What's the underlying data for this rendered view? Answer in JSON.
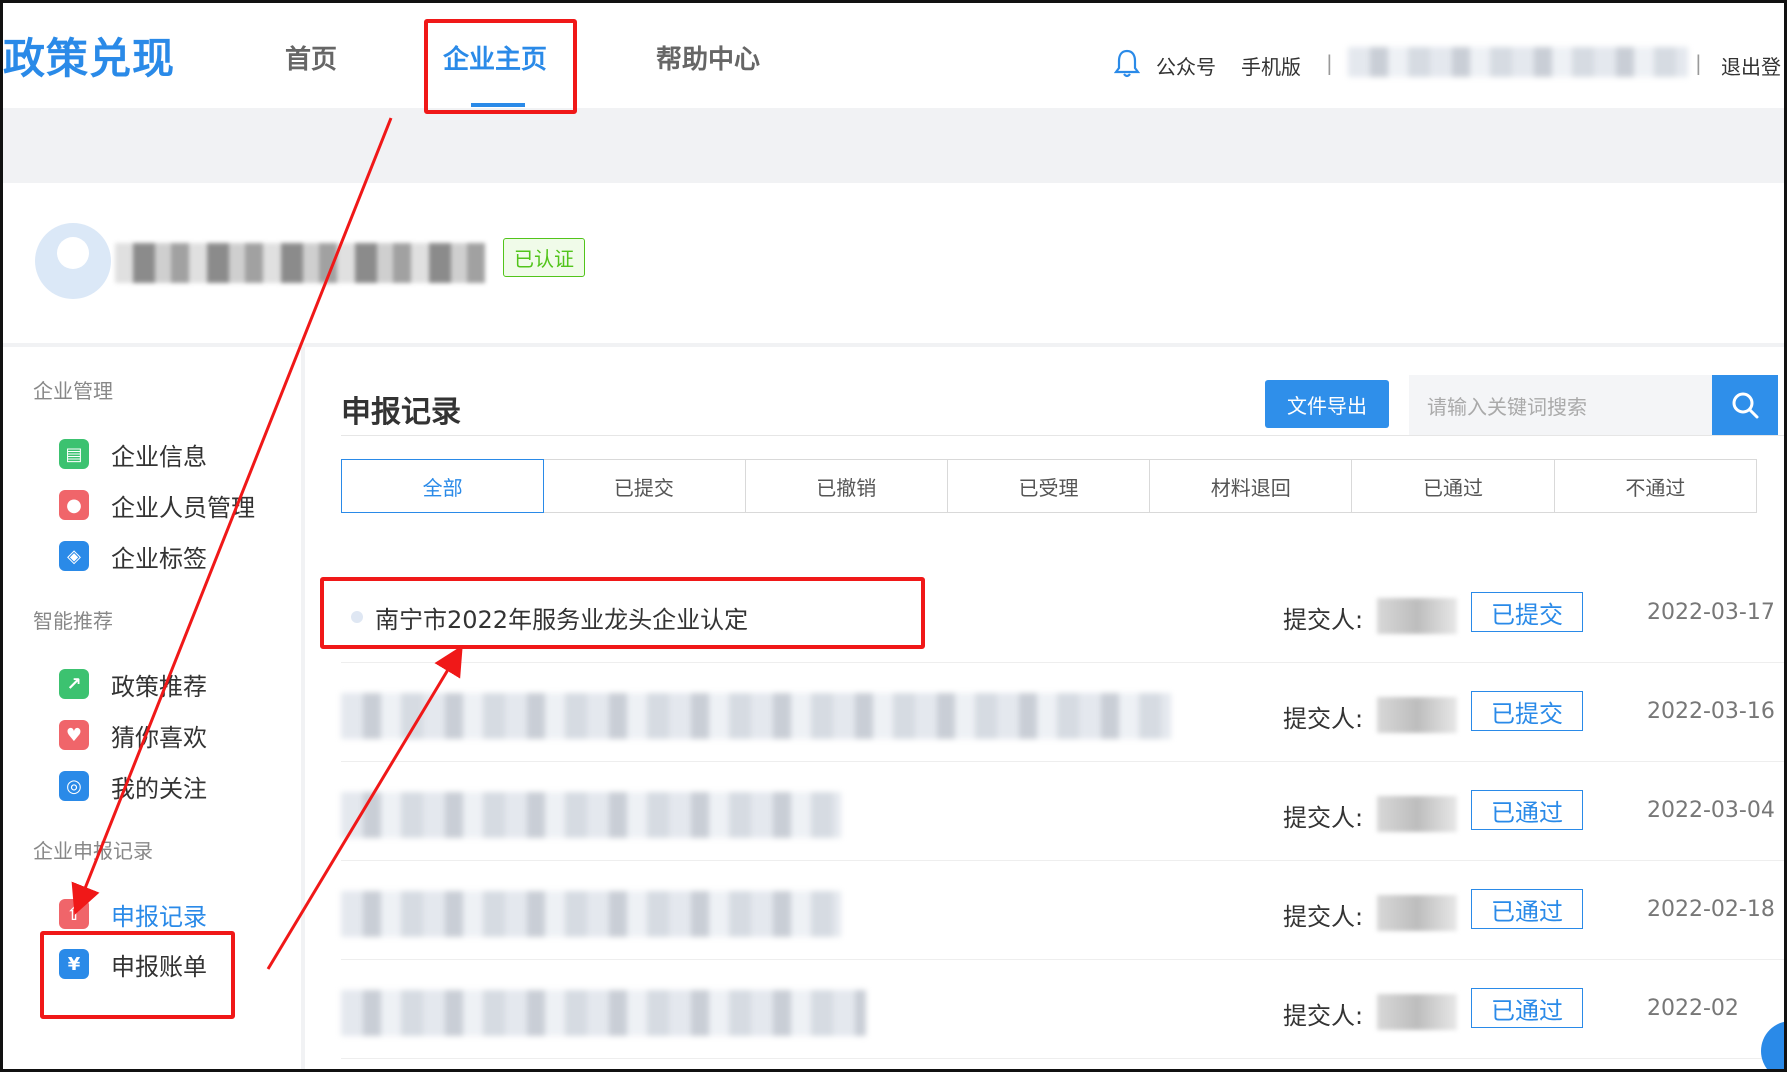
{
  "header": {
    "logo": "政策兑现",
    "nav": [
      "首页",
      "企业主页",
      "帮助中心"
    ],
    "links": {
      "wechat": "公众号",
      "mobile": "手机版",
      "logout": "退出登"
    }
  },
  "profile": {
    "badge": "已认证"
  },
  "sidebar": {
    "groups": [
      {
        "title": "企业管理",
        "items": [
          {
            "label": "企业信息",
            "icon": "building-icon",
            "color": "#3cc270"
          },
          {
            "label": "企业人员管理",
            "icon": "person-icon",
            "color": "#f0656a"
          },
          {
            "label": "企业标签",
            "icon": "tag-icon",
            "color": "#2a8ae8"
          }
        ]
      },
      {
        "title": "智能推荐",
        "items": [
          {
            "label": "政策推荐",
            "icon": "recommend-icon",
            "color": "#3cc270"
          },
          {
            "label": "猜你喜欢",
            "icon": "heart-icon",
            "color": "#f0656a"
          },
          {
            "label": "我的关注",
            "icon": "follow-icon",
            "color": "#2a8ae8"
          }
        ]
      },
      {
        "title": "企业申报记录",
        "items": [
          {
            "label": "申报记录",
            "icon": "upload-icon",
            "color": "#f0656a"
          },
          {
            "label": "申报账单",
            "icon": "yuan-icon",
            "color": "#2a8ae8"
          }
        ]
      }
    ]
  },
  "main": {
    "title": "申报记录",
    "export_label": "文件导出",
    "search_placeholder": "请输入关键词搜索",
    "tabs": [
      "全部",
      "已提交",
      "已撤销",
      "已受理",
      "材料退回",
      "已通过",
      "不通过"
    ],
    "submitter_label": "提交人:",
    "records": [
      {
        "title": "南宁市2022年服务业龙头企业认定",
        "status": "已提交",
        "date": "2022-03-17"
      },
      {
        "title": "",
        "status": "已提交",
        "date": "2022-03-16"
      },
      {
        "title": "",
        "status": "已通过",
        "date": "2022-03-04"
      },
      {
        "title": "",
        "status": "已通过",
        "date": "2022-02-18"
      },
      {
        "title": "",
        "status": "已通过",
        "date": "2022-02"
      }
    ]
  },
  "colors": {
    "accent": "#2a8ae8",
    "annotation": "#f01818",
    "verified": "#52c41a"
  }
}
